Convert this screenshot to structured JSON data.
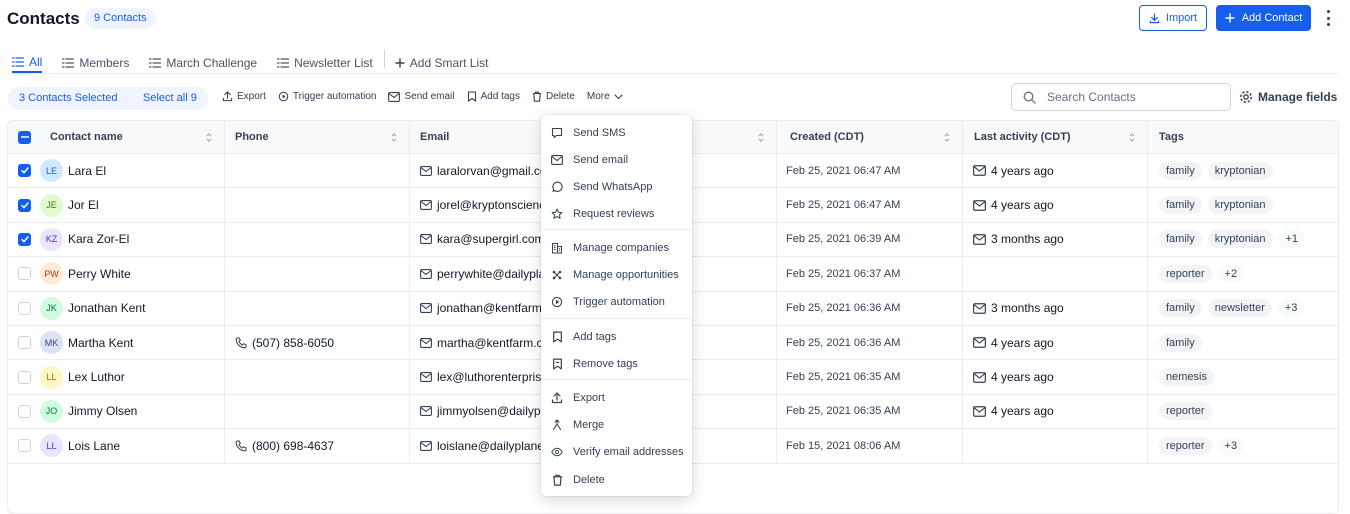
{
  "header": {
    "title": "Contacts",
    "count_badge": "9 Contacts",
    "import_label": "Import",
    "add_contact_label": "Add Contact"
  },
  "tabs": [
    {
      "label": "All",
      "active": true
    },
    {
      "label": "Members"
    },
    {
      "label": "March Challenge"
    },
    {
      "label": "Newsletter List"
    }
  ],
  "add_smart_list_label": "Add Smart List",
  "bulk": {
    "selected_text": "3 Contacts Selected",
    "select_all_text": "Select all 9",
    "actions": [
      "Export",
      "Trigger automation",
      "Send email",
      "Add tags",
      "Delete",
      "More"
    ]
  },
  "search": {
    "placeholder": "Search Contacts"
  },
  "manage_fields_label": "Manage fields",
  "columns": [
    "Contact name",
    "Phone",
    "Email",
    "Created (CDT)",
    "Last activity (CDT)",
    "Tags"
  ],
  "rows": [
    {
      "initials": "LE",
      "name": "Lara El",
      "phone": "",
      "email": "laralorvan@gmail.co",
      "created": "Feb 25, 2021 06:47 AM",
      "activity": "4 years ago",
      "tags": [
        "family",
        "kryptonian"
      ],
      "extra": "",
      "checked": true,
      "avatar_bg": "#d1e9ff",
      "avatar_fg": "#175cd3"
    },
    {
      "initials": "JE",
      "name": "Jor El",
      "phone": "",
      "email": "jorel@kryptonscienc",
      "created": "Feb 25, 2021 06:47 AM",
      "activity": "4 years ago",
      "tags": [
        "family",
        "kryptonian"
      ],
      "extra": "",
      "checked": true,
      "avatar_bg": "#e3fbcc",
      "avatar_fg": "#3b7c0f"
    },
    {
      "initials": "KZ",
      "name": "Kara Zor-El",
      "phone": "",
      "email": "kara@supergirl.com",
      "created": "Feb 25, 2021 06:39 AM",
      "activity": "3 months ago",
      "tags": [
        "family",
        "kryptonian"
      ],
      "extra": "+1",
      "checked": true,
      "avatar_bg": "#e9e5fd",
      "avatar_fg": "#5925dc"
    },
    {
      "initials": "PW",
      "name": "Perry White",
      "phone": "",
      "email": "perrywhite@dailypla",
      "created": "Feb 25, 2021 06:37 AM",
      "activity": "",
      "tags": [
        "reporter"
      ],
      "extra": "+2",
      "checked": false,
      "avatar_bg": "#fdead7",
      "avatar_fg": "#b93815"
    },
    {
      "initials": "JK",
      "name": "Jonathan Kent",
      "phone": "",
      "email": "jonathan@kentfarm.c",
      "created": "Feb 25, 2021 06:36 AM",
      "activity": "3 months ago",
      "tags": [
        "family",
        "newsletter"
      ],
      "extra": "+3",
      "checked": false,
      "avatar_bg": "#d1fadf",
      "avatar_fg": "#087443"
    },
    {
      "initials": "MK",
      "name": "Martha Kent",
      "phone": "(507) 858-6050",
      "email": "martha@kentfarm.co",
      "created": "Feb 25, 2021 06:36 AM",
      "activity": "4 years ago",
      "tags": [
        "family"
      ],
      "extra": "",
      "checked": false,
      "avatar_bg": "#dde3f5",
      "avatar_fg": "#3e4784"
    },
    {
      "initials": "LL",
      "name": "Lex Luthor",
      "phone": "",
      "email": "lex@luthorenterprise",
      "created": "Feb 25, 2021 06:35 AM",
      "activity": "4 years ago",
      "tags": [
        "nemesis"
      ],
      "extra": "",
      "checked": false,
      "avatar_bg": "#fef7c3",
      "avatar_fg": "#a15c07"
    },
    {
      "initials": "JO",
      "name": "Jimmy Olsen",
      "phone": "",
      "email": "jimmyolsen@dailypla",
      "created": "Feb 25, 2021 06:35 AM",
      "activity": "4 years ago",
      "tags": [
        "reporter"
      ],
      "extra": "",
      "checked": false,
      "avatar_bg": "#d1fadf",
      "avatar_fg": "#087443"
    },
    {
      "initials": "LL",
      "name": "Lois Lane",
      "phone": "(800) 698-4637",
      "email": "loislane@dailyplanet",
      "created": "Feb 15, 2021 08:06 AM",
      "activity": "",
      "tags": [
        "reporter"
      ],
      "extra": "+3",
      "checked": false,
      "avatar_bg": "#e9e5fd",
      "avatar_fg": "#5925dc"
    }
  ],
  "more_menu": [
    {
      "label": "Send SMS",
      "icon": "chat-icon"
    },
    {
      "label": "Send email",
      "icon": "mail-icon"
    },
    {
      "label": "Send WhatsApp",
      "icon": "whatsapp-icon"
    },
    {
      "label": "Request reviews",
      "icon": "star-icon"
    },
    {
      "label": "Manage companies",
      "icon": "building-icon"
    },
    {
      "label": "Manage opportunities",
      "icon": "opportunities-icon"
    },
    {
      "label": "Trigger automation",
      "icon": "automation-icon"
    },
    {
      "label": "Add tags",
      "icon": "tag-icon"
    },
    {
      "label": "Remove tags",
      "icon": "tag-remove-icon"
    },
    {
      "label": "Export",
      "icon": "export-icon"
    },
    {
      "label": "Merge",
      "icon": "merge-icon"
    },
    {
      "label": "Verify email addresses",
      "icon": "eye-icon"
    },
    {
      "label": "Delete",
      "icon": "trash-icon"
    }
  ],
  "colors": {
    "accent": "#155eef",
    "border": "#eaecf0",
    "chip_bg": "#f2f4f7"
  }
}
